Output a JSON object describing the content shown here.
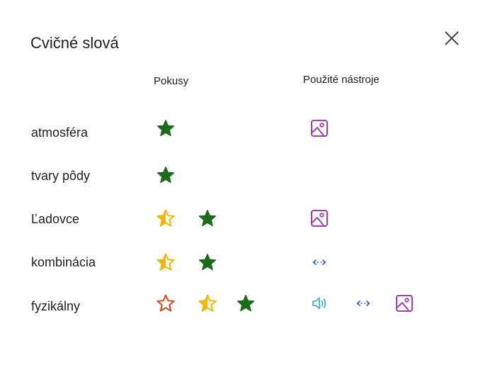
{
  "dialog": {
    "title": "Cvičné slová",
    "close_icon": "close-icon"
  },
  "columns": {
    "attempts": "Pokusy",
    "tools": "Použité nástroje"
  },
  "rows": [
    {
      "word": "atmosféra",
      "attempts": [
        "correct"
      ],
      "tools": [
        "picture-dictionary"
      ]
    },
    {
      "word": "tvary pôdy",
      "attempts": [
        "correct"
      ],
      "tools": []
    },
    {
      "word": "Ľadovce",
      "attempts": [
        "half-correct",
        "correct"
      ],
      "tools": [
        "picture-dictionary"
      ]
    },
    {
      "word": "kombinácia",
      "attempts": [
        "half-correct",
        "correct"
      ],
      "tools": [
        "syllables"
      ]
    },
    {
      "word": "fyzikálny",
      "attempts": [
        "incorrect",
        "half-correct",
        "correct"
      ],
      "tools": [
        "read-aloud",
        "syllables",
        "picture-dictionary"
      ]
    }
  ],
  "colors": {
    "correct": "#1a6b1a",
    "half": "#f2b705",
    "incorrect": "#d9471c",
    "picture": "#a33fb5",
    "syllables": "#3d6be0",
    "read_aloud": "#3fb6c9"
  }
}
